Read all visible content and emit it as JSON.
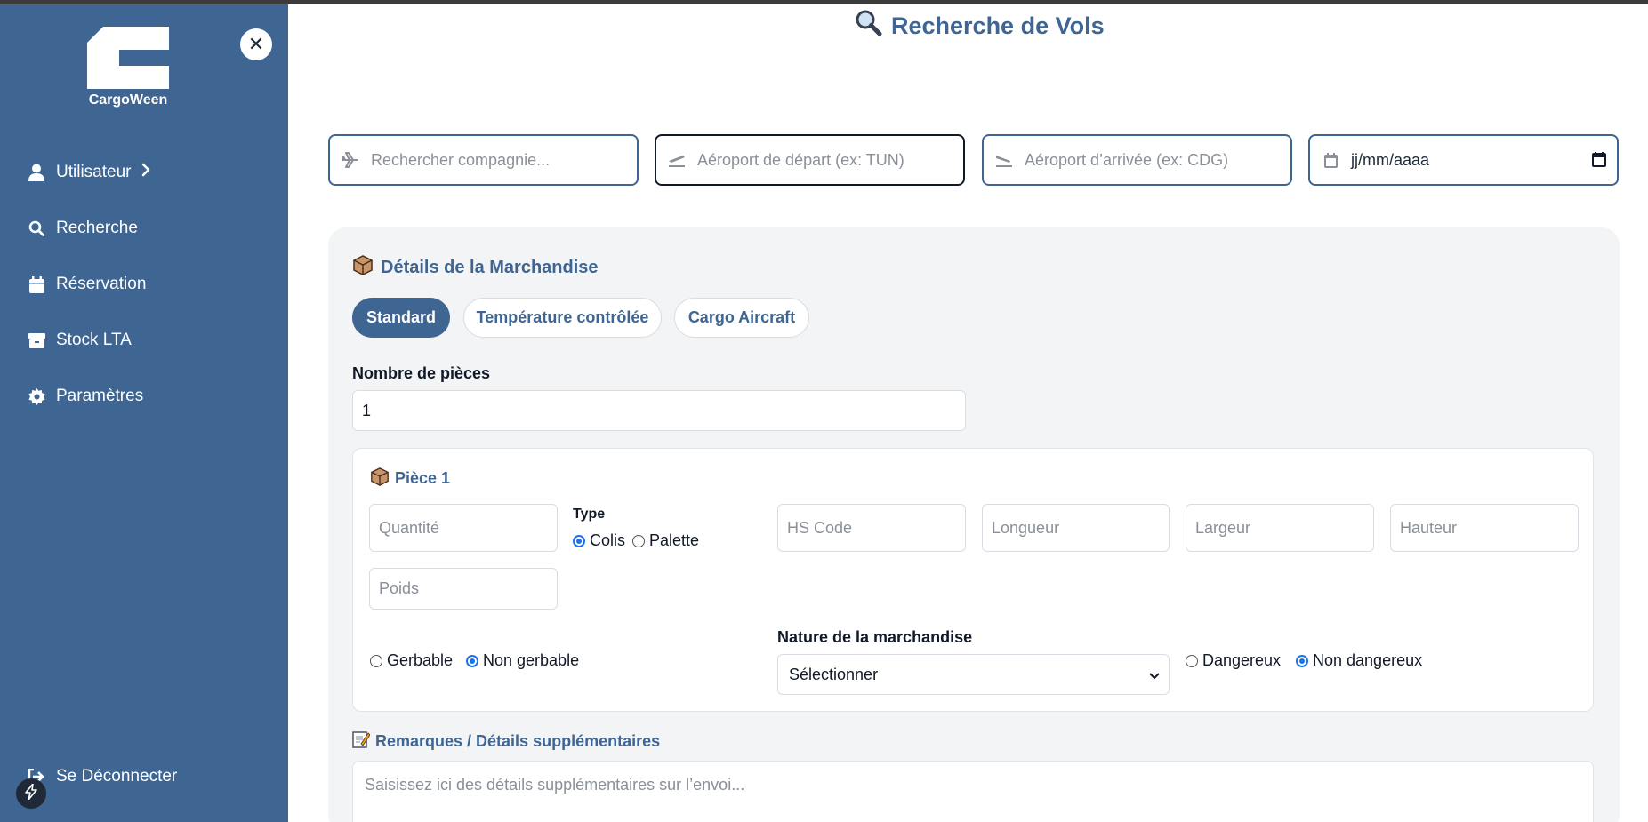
{
  "app": {
    "brand": "CargoWeen"
  },
  "sidebar": {
    "items": [
      {
        "label": "Utilisateur",
        "icon": "user-icon"
      },
      {
        "label": "Recherche",
        "icon": "search-icon"
      },
      {
        "label": "Réservation",
        "icon": "calendar-icon"
      },
      {
        "label": "Stock LTA",
        "icon": "box-icon"
      },
      {
        "label": "Paramètres",
        "icon": "gear-icon"
      }
    ],
    "logout_label": "Se Déconnecter"
  },
  "page": {
    "title": "Recherche de Vols"
  },
  "search": {
    "company_placeholder": "Rechercher compagnie...",
    "departure_placeholder": "Aéroport de départ (ex: TUN)",
    "arrival_placeholder": "Aéroport d’arrivée (ex: CDG)",
    "date_value": "jj/mm/aaaa"
  },
  "merch": {
    "title": "Détails de la Marchandise",
    "tabs": [
      "Standard",
      "Température contrôlée",
      "Cargo Aircraft"
    ],
    "active_tab": "Standard",
    "pieces_label": "Nombre de pièces",
    "pieces_value": "1"
  },
  "piece": {
    "title": "Pièce 1",
    "quantity_placeholder": "Quantité",
    "type_label": "Type",
    "type_options": [
      "Colis",
      "Palette"
    ],
    "type_selected": "Colis",
    "hs_placeholder": "HS Code",
    "length_placeholder": "Longueur",
    "width_placeholder": "Largeur",
    "height_placeholder": "Hauteur",
    "weight_placeholder": "Poids",
    "stack_options": [
      "Gerbable",
      "Non gerbable"
    ],
    "stack_selected": "Non gerbable",
    "nature_label": "Nature de la marchandise",
    "nature_value": "Sélectionner",
    "danger_options": [
      "Dangereux",
      "Non dangereux"
    ],
    "danger_selected": "Non dangereux"
  },
  "remarks": {
    "title": "Remarques / Détails supplémentaires",
    "placeholder": "Saisissez ici des détails supplémentaires sur l’envoi..."
  },
  "colors": {
    "primary": "#3f6592",
    "panel": "#f3f4f6",
    "radio": "#1a73e8"
  }
}
